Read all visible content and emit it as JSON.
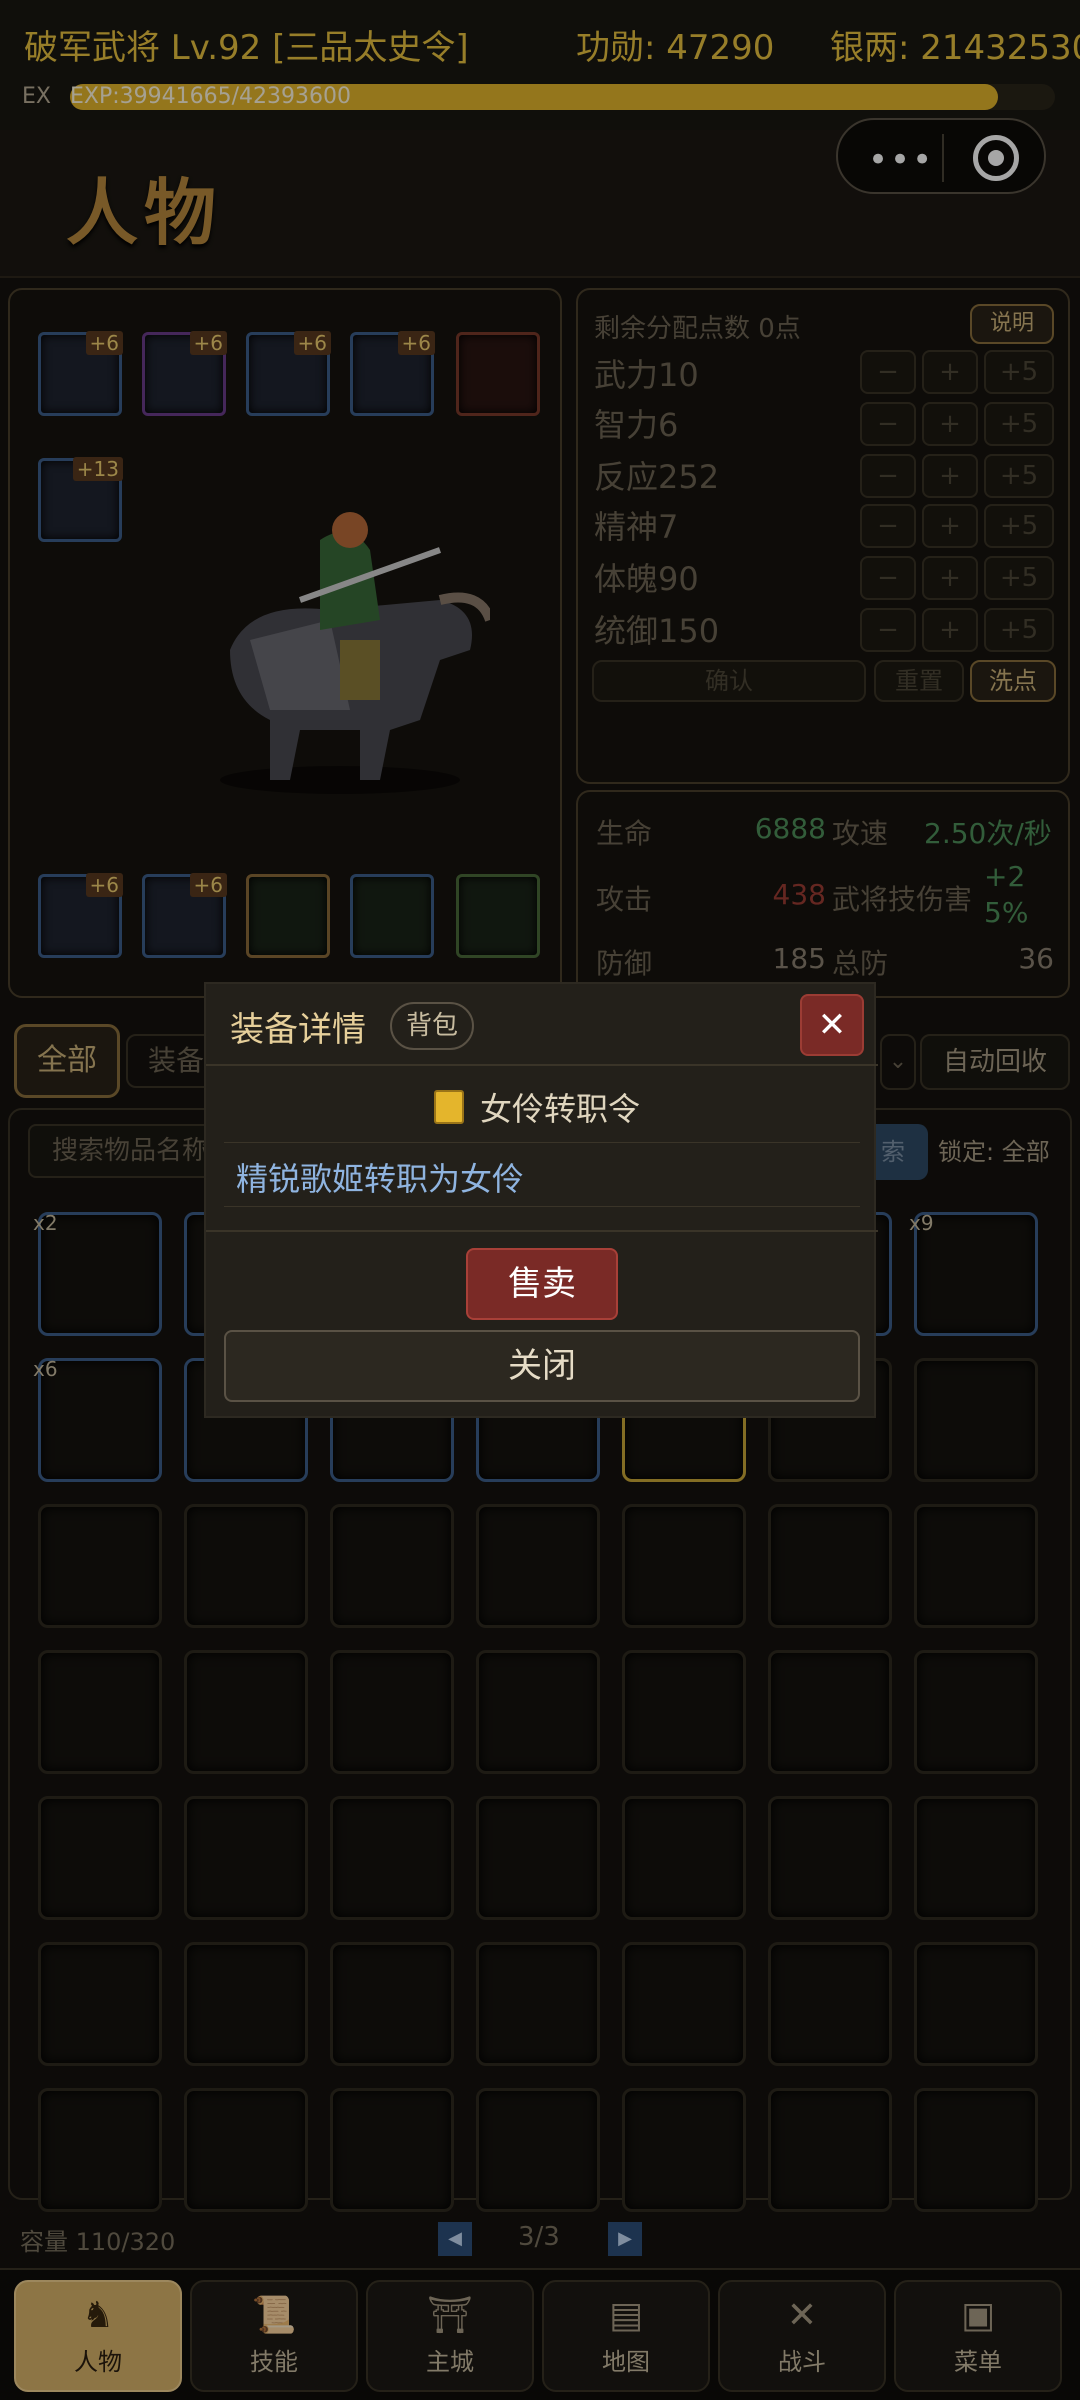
{
  "player": {
    "title": "破军武将 Lv.92 [三品太史令]",
    "merit": "功勋: 47290",
    "silver": "银两: 21432530",
    "exp_label": "EX",
    "exp_text": "EXP:39941665/42393600",
    "exp_current": 39941665,
    "exp_max": 42393600
  },
  "capsule": {
    "dots": "•••"
  },
  "header": {
    "title": "人物"
  },
  "equipment": {
    "top_slots": [
      {
        "bonus": "+6",
        "color": "#3c5f8a"
      },
      {
        "bonus": "+6",
        "color": "#6a3c8a"
      },
      {
        "bonus": "+6",
        "color": "#3c5f8a"
      },
      {
        "bonus": "+6",
        "color": "#3c5f8a"
      },
      {
        "bonus": "",
        "color": "#7a3a2a"
      }
    ],
    "weapon_slot_bonus": "+13",
    "bottom_slots": [
      {
        "bonus": "+6"
      },
      {
        "bonus": "+6"
      },
      {
        "bonus": ""
      },
      {
        "bonus": ""
      },
      {
        "bonus": ""
      }
    ]
  },
  "stats": {
    "remaining": "剩余分配点数 0点",
    "explain": "说明",
    "rows": [
      {
        "label": "武力10"
      },
      {
        "label": "智力6"
      },
      {
        "label": "反应252"
      },
      {
        "label": "精神7"
      },
      {
        "label": "体魄90"
      },
      {
        "label": "统御150"
      }
    ],
    "minus": "−",
    "plus": "+",
    "plus5": "+5",
    "confirm": "确认",
    "reset": "重置",
    "wash": "洗点"
  },
  "attributes": {
    "hp_label": "生命",
    "hp_value": "6888",
    "speed_label": "攻速",
    "speed_value": "2.50次/秒",
    "atk_label": "攻击",
    "atk_value": "438",
    "skill_dmg_label": "武将技伤害",
    "skill_dmg_value_1": "+2",
    "skill_dmg_value_2": "5%",
    "def_label": "防御",
    "def_value": "185",
    "total_def_label": "总防",
    "total_def_value": "36",
    "colors": {
      "hp": "#4e8f5a",
      "atk": "#9c3c34"
    }
  },
  "bag": {
    "tab_all": "全部",
    "tab_equip": "装备",
    "auto_recycle": "自动回收",
    "search_placeholder": "搜索物品名称",
    "search_btn": "索",
    "lock": "锁定: 全部",
    "counts": {
      "c0": "x2",
      "c6": "x9",
      "c7": "x6"
    },
    "capacity": "容量 110/320",
    "page": "3/3",
    "prev": "◀",
    "next": "▶"
  },
  "nav": [
    {
      "label": "人物",
      "icon": "♞"
    },
    {
      "label": "技能",
      "icon": "📜"
    },
    {
      "label": "主城",
      "icon": "⛩"
    },
    {
      "label": "地图",
      "icon": "▤"
    },
    {
      "label": "战斗",
      "icon": "✕"
    },
    {
      "label": "菜单",
      "icon": "▣"
    }
  ],
  "modal": {
    "title": "装备详情",
    "tag": "背包",
    "close_x": "✕",
    "item_name": "女伶转职令",
    "item_desc": "精锐歌姬转职为女伶",
    "sell": "售卖",
    "close": "关闭"
  }
}
